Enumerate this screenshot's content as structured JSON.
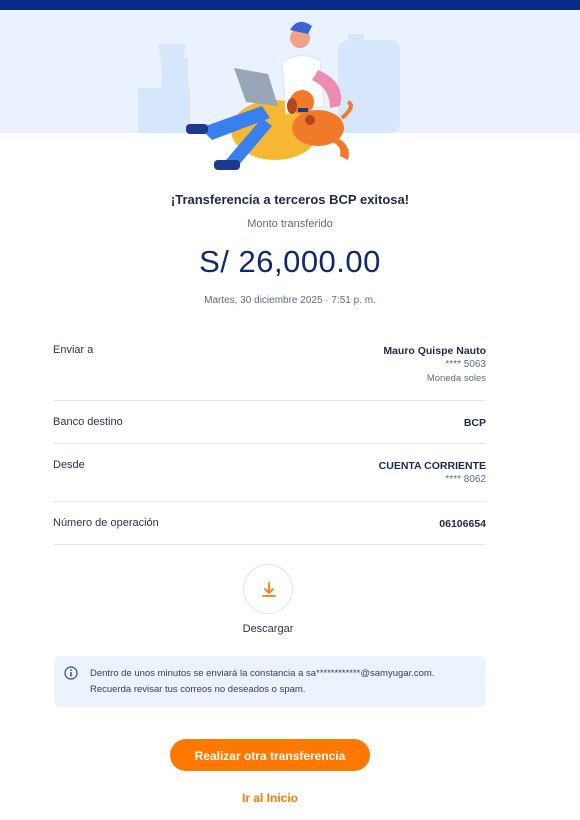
{
  "header": {
    "title": "¡Transferencia a terceros BCP exitosa!"
  },
  "amount": {
    "label": "Monto transferido",
    "value": "S/ 26,000.00"
  },
  "date": "Martes, 30 diciembre 2025 · 7:51 p. m.",
  "details": {
    "enviar_a": {
      "label": "Enviar a",
      "name": "Mauro Quispe Nauto",
      "account": "**** 5063",
      "currency": "Moneda soles"
    },
    "banco": {
      "label": "Banco destino",
      "value": "BCP"
    },
    "desde": {
      "label": "Desde",
      "value": "CUENTA CORRIENTE",
      "account": "**** 8062"
    },
    "operacion": {
      "label": "Número de operación",
      "value": "06106654"
    }
  },
  "download": {
    "label": "Descargar",
    "icon": "download-icon"
  },
  "info": {
    "icon": "info-icon",
    "line1": "Dentro de unos minutos se enviará la constancia a sa************@samyugar.com.",
    "line2": "Recuerda revisar tus correos no deseados o spam."
  },
  "actions": {
    "primary": "Realizar otra transferencia",
    "secondary": "Ir al Inicio"
  },
  "colors": {
    "brand_blue": "#0b2a8a",
    "accent_orange": "#ff7800",
    "amount_blue": "#0b2a6f"
  }
}
